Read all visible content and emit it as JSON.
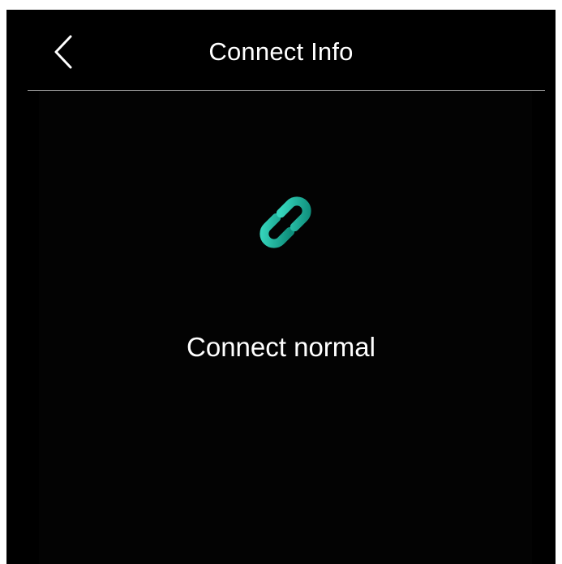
{
  "header": {
    "back_icon": "chevron-left-icon",
    "title": "Connect Info"
  },
  "status": {
    "icon": "link-icon",
    "icon_color_start": "#2ec9b0",
    "icon_color_end": "#129a86",
    "text": "Connect normal"
  },
  "colors": {
    "background": "#000000",
    "text": "#ffffff",
    "divider": "#8a8a8a"
  }
}
